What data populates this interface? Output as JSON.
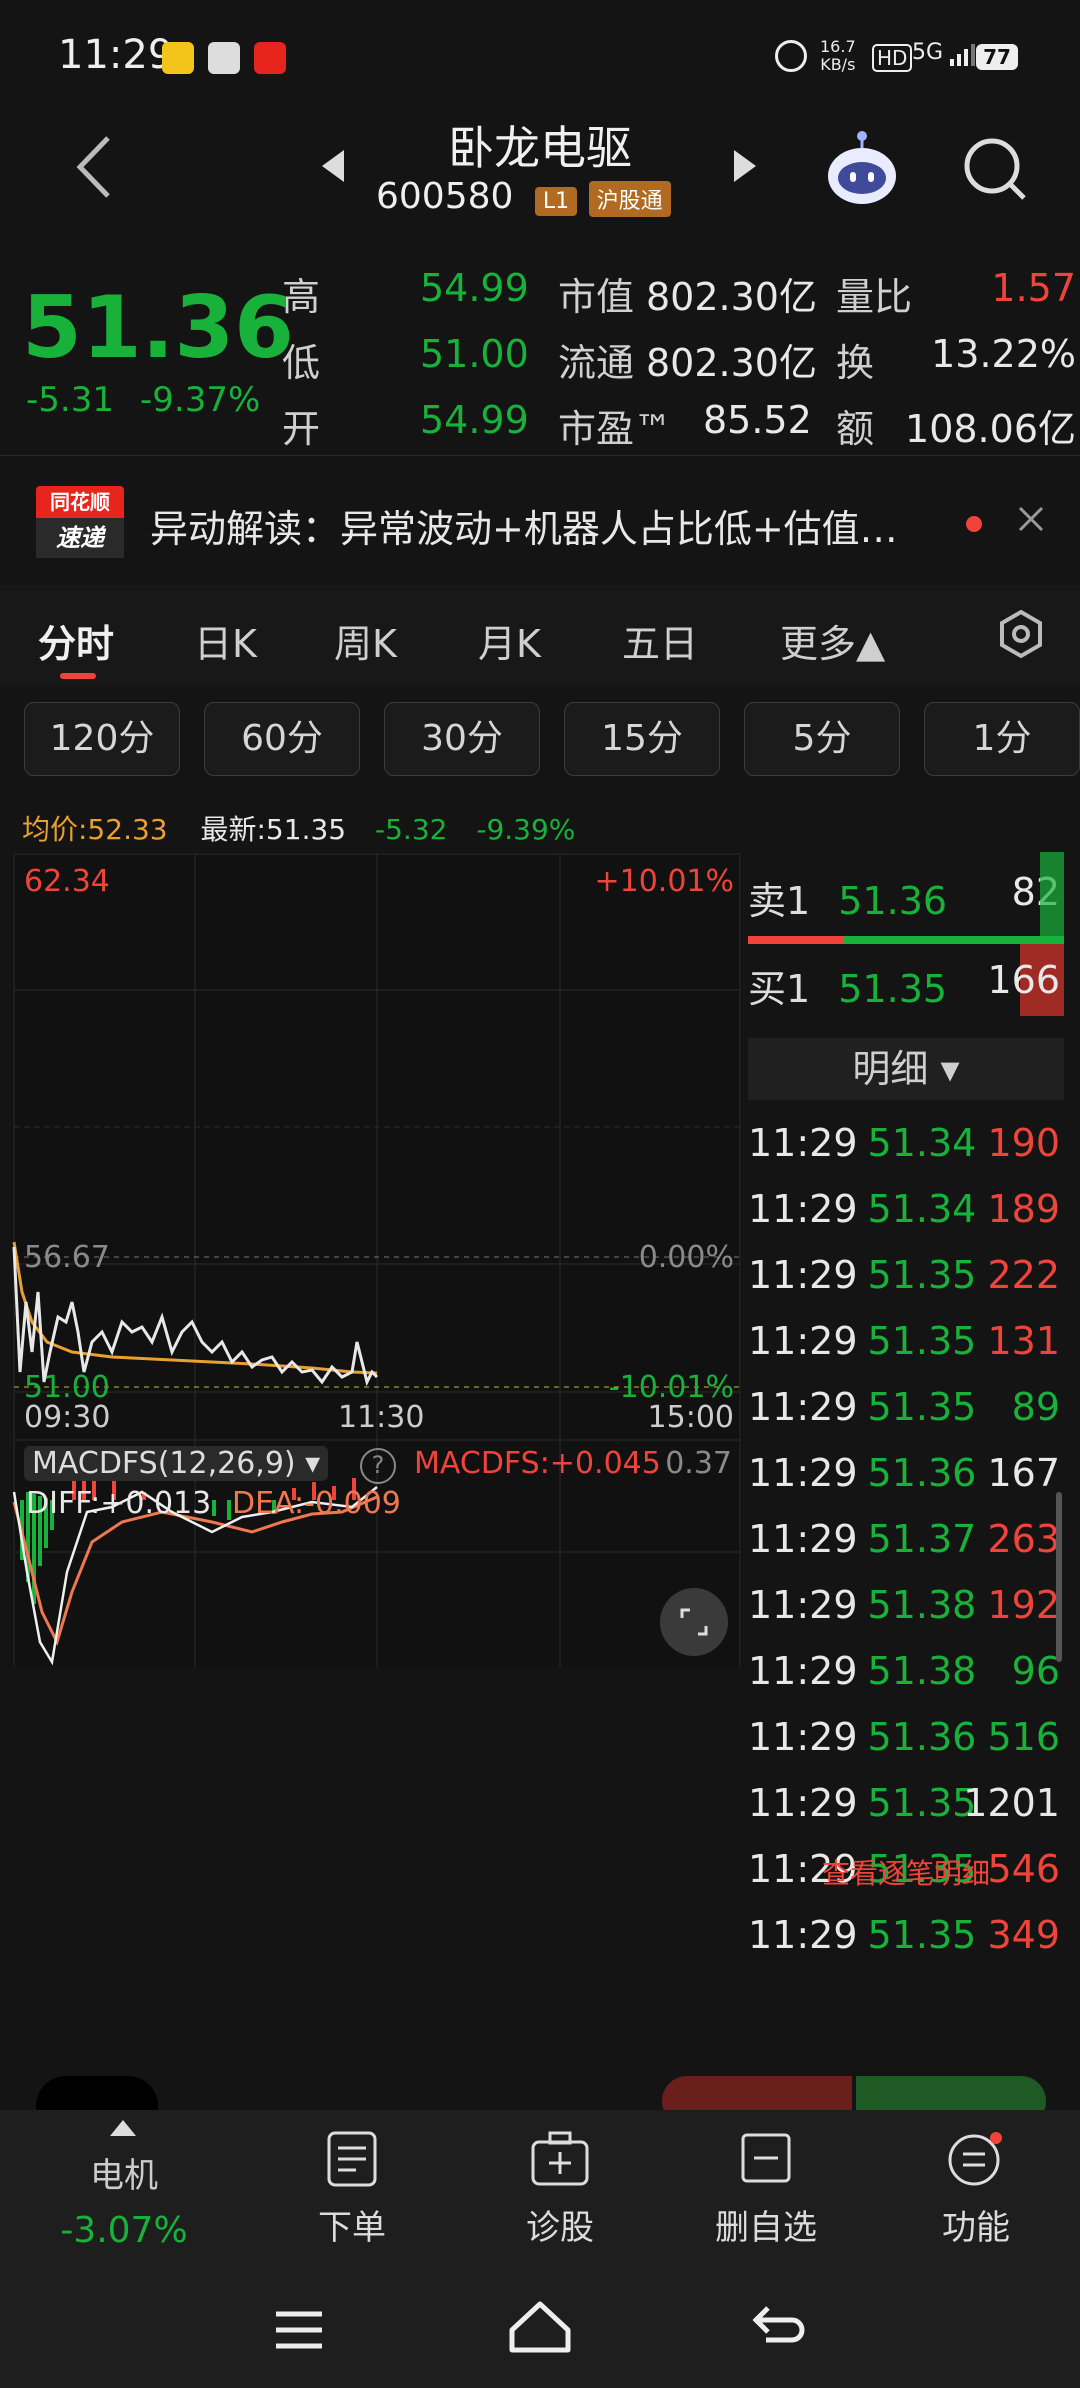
{
  "status": {
    "time": "11:29",
    "net_speed": "16.7",
    "net_unit": "KB/s",
    "hd": "HD",
    "net": "5G",
    "battery": "77"
  },
  "nav": {
    "title": "卧龙电驱",
    "code": "600580",
    "level_tag": "L1",
    "exchange_tag": "沪股通"
  },
  "quote": {
    "price": "51.36",
    "change": "-5.31",
    "change_pct": "-9.37%",
    "high_label": "高",
    "high": "54.99",
    "low_label": "低",
    "low": "51.00",
    "open_label": "开",
    "open": "54.99",
    "mcap_label": "市值",
    "mcap": "802.30亿",
    "float_label": "流通",
    "float": "802.30亿",
    "pe_label": "市盈™",
    "pe": "85.52",
    "vr_label": "量比",
    "vr": "1.57",
    "turn_label": "换",
    "turn": "13.22%",
    "amt_label": "额",
    "amt": "108.06亿"
  },
  "news": {
    "badge_top": "同花顺",
    "badge_bottom": "速递",
    "text": "异动解读：异常波动+机器人占比低+估值…"
  },
  "tabs": [
    "分时",
    "日K",
    "周K",
    "月K",
    "五日",
    "更多▲"
  ],
  "intervals": [
    "120分",
    "60分",
    "30分",
    "15分",
    "5分",
    "1分"
  ],
  "infoline": {
    "avg_label": "均价:52.33",
    "latest_label": "最新:51.35",
    "chg": "-5.32",
    "chg_pct": "-9.39%"
  },
  "chart": {
    "upper_price": "62.34",
    "upper_pct": "+10.01%",
    "mid_price": "56.67",
    "mid_pct": "0.00%",
    "lower_price": "51.00",
    "lower_pct": "-10.01%",
    "t_start": "09:30",
    "t_mid": "11:30",
    "t_end": "15:00",
    "macd_title": "MACDFS(12,26,9)",
    "macd_value": "MACDFS:+0.045",
    "macd_max": "0.37",
    "diff": "DIFF:+0.013",
    "dea": "DEA:-0.009",
    "colors": {
      "price_line": "#e8e8e8",
      "avg_line": "#e8a030"
    }
  },
  "book": {
    "sell_label": "卖1",
    "sell_price": "51.36",
    "sell_vol": "82",
    "buy_label": "买1",
    "buy_price": "51.35",
    "buy_vol": "166",
    "detail_label": "明细 ▾",
    "ticks": [
      {
        "t": "11:29",
        "p": "51.34",
        "v": "190",
        "c": "red"
      },
      {
        "t": "11:29",
        "p": "51.34",
        "v": "189",
        "c": "red"
      },
      {
        "t": "11:29",
        "p": "51.35",
        "v": "222",
        "c": "red"
      },
      {
        "t": "11:29",
        "p": "51.35",
        "v": "131",
        "c": "red"
      },
      {
        "t": "11:29",
        "p": "51.35",
        "v": "89",
        "c": "green"
      },
      {
        "t": "11:29",
        "p": "51.36",
        "v": "167",
        "c": "white"
      },
      {
        "t": "11:29",
        "p": "51.37",
        "v": "263",
        "c": "red"
      },
      {
        "t": "11:29",
        "p": "51.38",
        "v": "192",
        "c": "red"
      },
      {
        "t": "11:29",
        "p": "51.38",
        "v": "96",
        "c": "green"
      },
      {
        "t": "11:29",
        "p": "51.36",
        "v": "516",
        "c": "green"
      },
      {
        "t": "11:29",
        "p": "51.35",
        "v": "1201",
        "c": "white"
      },
      {
        "t": "11:29",
        "p": "51.35",
        "v": "546",
        "c": "red"
      },
      {
        "t": "11:29",
        "p": "51.35",
        "v": "349",
        "c": "red"
      }
    ],
    "see_detail": "查看逐笔明细"
  },
  "bottom": {
    "sector": "电机",
    "sector_pct": "-3.07%",
    "items": [
      "下单",
      "诊股",
      "删自选",
      "功能"
    ]
  }
}
